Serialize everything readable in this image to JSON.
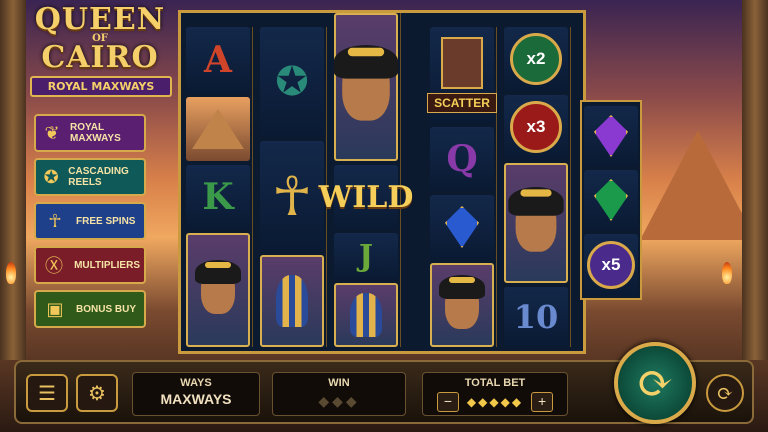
{
  "logo": {
    "line1": "QUEEN",
    "line2": "OF",
    "line3": "CAIRO",
    "subtitle": "ROYAL MAXWAYS"
  },
  "features": [
    {
      "label": "ROYAL MAXWAYS",
      "icon": "scarab-wings-icon"
    },
    {
      "label": "CASCADING REELS",
      "icon": "scarab-icon"
    },
    {
      "label": "FREE SPINS",
      "icon": "ankh-icon"
    },
    {
      "label": "MULTIPLIERS",
      "icon": "x-icon"
    },
    {
      "label": "BONUS BUY",
      "icon": "chest-icon"
    }
  ],
  "reels": {
    "r1": [
      "A",
      "pyramid",
      "K",
      "queen"
    ],
    "r2": [
      "scarab",
      "ankh",
      "pharaoh"
    ],
    "r3": [
      "queen",
      "WILD",
      "J",
      "pharaoh"
    ],
    "r4": [
      "SCATTER",
      "Q",
      "sapphire",
      "queen"
    ],
    "r5": [
      "x2",
      "x3",
      "queen",
      "10"
    ],
    "r6": [
      "amethyst",
      "emerald",
      "x5"
    ]
  },
  "controls": {
    "ways_label": "WAYS",
    "ways_value": "MAXWAYS",
    "win_label": "WIN",
    "win_dots": "◆◆◆",
    "bet_label": "TOTAL BET",
    "bet_minus": "−",
    "bet_plus": "+",
    "bet_dots": "◆◆◆◆◆",
    "menu_icon": "☰",
    "settings_icon": "⚙",
    "spin_icon": "⟳",
    "autoplay_icon": "⟳"
  },
  "colors": {
    "gold": "#d9a94a",
    "spin": "#1f7a60"
  }
}
